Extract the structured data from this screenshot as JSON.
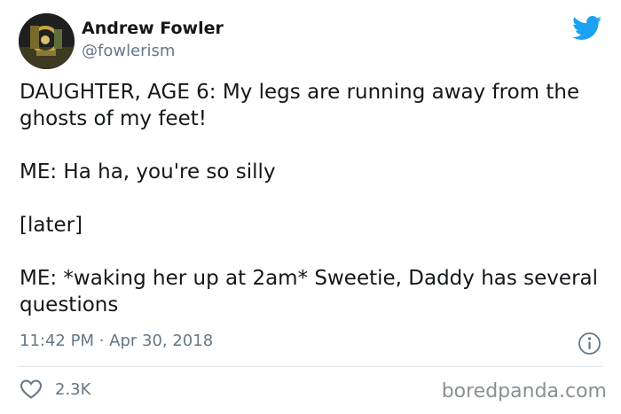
{
  "tweet": {
    "author_name": "Andrew Fowler",
    "author_handle": "@fowlerism",
    "text_paragraphs": [
      "DAUGHTER, AGE 6: My legs are running away from the ghosts of my feet!",
      "ME: Ha ha, you're so silly",
      "[later]",
      "ME: *waking her up at 2am* Sweetie, Daddy has several questions"
    ],
    "timestamp": "11:42 PM · Apr 30, 2018",
    "like_count": "2.3K"
  },
  "icons": {
    "platform_logo": "twitter-bird-icon",
    "info": "info-icon",
    "like": "heart-icon"
  },
  "colors": {
    "brand_blue": "#1da1f2",
    "secondary_text": "#657786",
    "primary_text": "#14171a",
    "divider": "#e1e8ed"
  },
  "watermark": "boredpanda.com"
}
